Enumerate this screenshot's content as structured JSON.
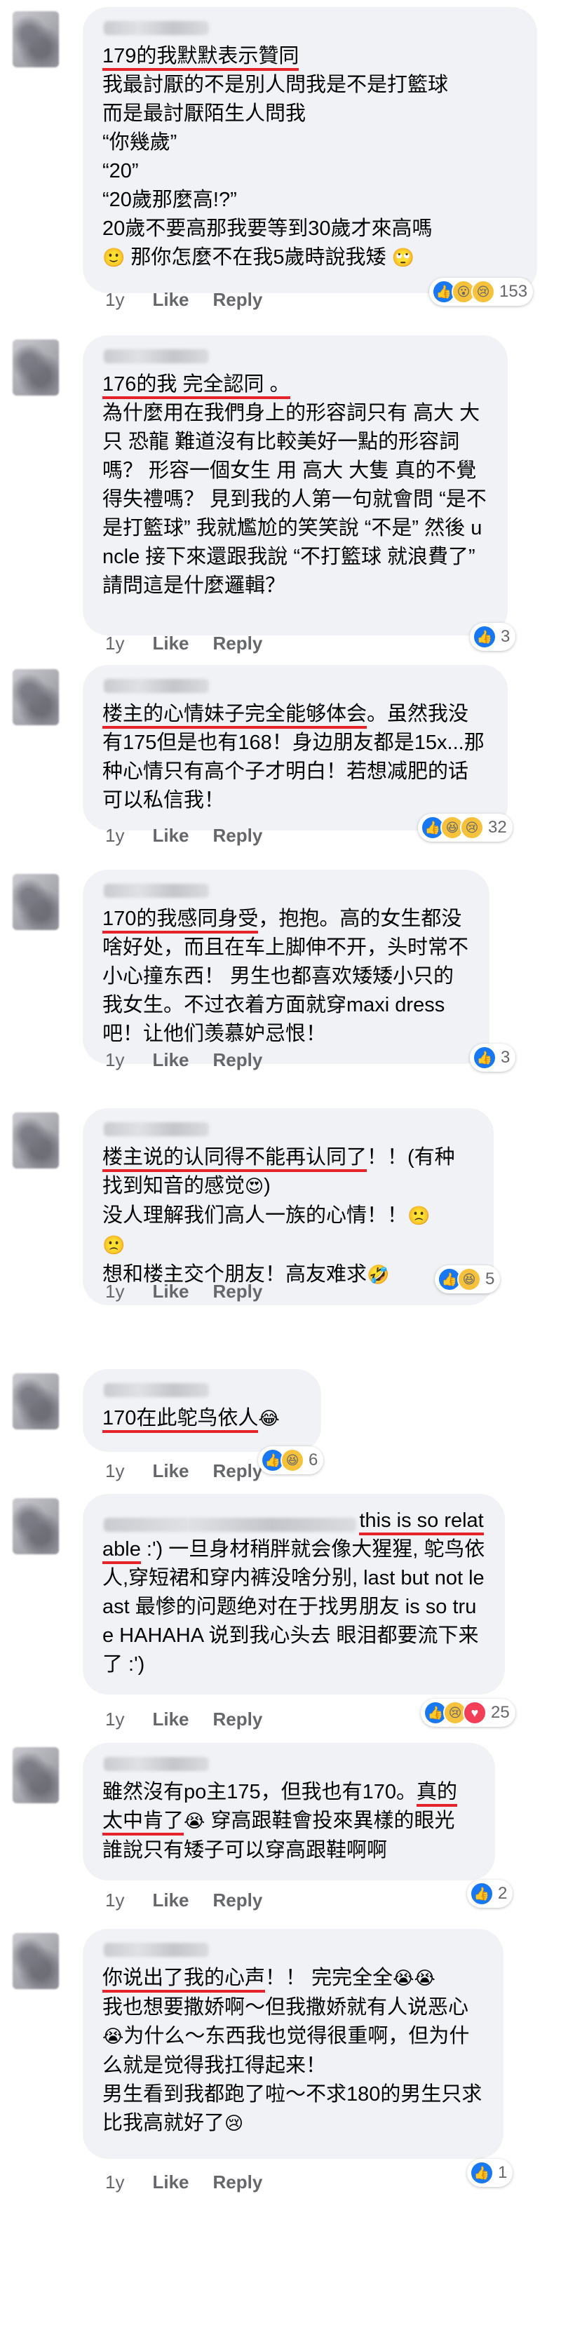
{
  "ui": {
    "like": "Like",
    "reply": "Reply"
  },
  "comments": [
    {
      "parts": [
        {
          "t": "179的我默默表示贊同",
          "hl": true
        },
        {
          "t": "\n我最討厭的不是別人問我是不是打籃球\n而是最討厭陌生人問我\n“你幾歲”\n“20”\n“20歲那麼高!?”\n20歲不要高那我要等到30歲才來高嗎\n"
        },
        {
          "t": "🙂",
          "e": true
        },
        {
          "t": " 那你怎麼不在我5歲時說我矮 "
        },
        {
          "t": "🙄",
          "e": true
        }
      ],
      "time": "1y",
      "reactions": [
        "like",
        "wow",
        "sad"
      ],
      "count": "153"
    },
    {
      "parts": [
        {
          "t": "176的我 完全認同 。",
          "hl": true
        },
        {
          "t": "\n為什麼用在我們身上的形容詞只有 高大 大只 恐龍 難道沒有比較美好一點的形容詞嗎？ 形容一個女生 用 高大 大隻 真的不覺得失禮嗎？ 見到我的人第一句就會問 “是不是打籃球” 我就尷尬的笑笑說 “不是” 然後 uncle 接下來還跟我說 “不打籃球 就浪費了” 請問這是什麼邏輯？"
        }
      ],
      "time": "1y",
      "reactions": [
        "like"
      ],
      "count": "3"
    },
    {
      "parts": [
        {
          "t": "楼主的心情妹子完全能够体会",
          "hl": true
        },
        {
          "t": "。虽然我没有175但是也有168！身边朋友都是15x...那种心情只有高个子才明白！若想减肥的话可以私信我！"
        }
      ],
      "time": "1y",
      "reactions": [
        "like",
        "haha",
        "sad"
      ],
      "count": "32"
    },
    {
      "parts": [
        {
          "t": "170的我感同身受",
          "hl": true
        },
        {
          "t": "，抱抱。高的女生都没啥好处，而且在车上脚伸不开，头时常不小心撞东西！ 男生也都喜欢矮矮小只的我女生。不过衣着方面就穿maxi dress 吧！让他们羡慕妒忌恨！"
        }
      ],
      "time": "1y",
      "reactions": [
        "like"
      ],
      "count": "3"
    },
    {
      "parts": [
        {
          "t": "楼主说的认同得不能再认同了",
          "hl": true
        },
        {
          "t": "！！(有种找到知音的感觉"
        },
        {
          "t": "😍",
          "e": true
        },
        {
          "t": ")\n没人理解我们高人一族的心情！！"
        },
        {
          "t": "🙁",
          "e": true
        },
        {
          "t": "\n"
        },
        {
          "t": "🙁",
          "e": true
        },
        {
          "t": "\n想和楼主交个朋友！高友难求"
        },
        {
          "t": "🤣",
          "e": true
        }
      ],
      "time": "1y",
      "reactions": [
        "like",
        "haha"
      ],
      "count": "5"
    },
    {
      "parts": [
        {
          "t": "170在此鸵鸟依人",
          "hl": true
        },
        {
          "t": "😂",
          "e": true
        }
      ],
      "time": "1y",
      "reactions": [
        "like",
        "haha"
      ],
      "count": "6"
    },
    {
      "parts": [
        {
          "t": "this is so relatable",
          "hl": true
        },
        {
          "t": " :') 一旦身材稍胖就会像大猩猩, 鸵鸟依人,穿短裙和穿内裤没啥分别, last but not least 最惨的问题绝对在于找男朋友 is so true HAHAHA 说到我心头去 眼泪都要流下来了 :')"
        }
      ],
      "time": "1y",
      "reactions": [
        "like",
        "sad",
        "love"
      ],
      "count": "25"
    },
    {
      "parts": [
        {
          "t": "雖然沒有po主175，但我也有170。"
        },
        {
          "t": "真的太中肯了",
          "hl": true
        },
        {
          "t": "😭",
          "e": true
        },
        {
          "t": " 穿高跟鞋會投來異樣的眼光 誰說只有矮子可以穿高跟鞋啊啊"
        }
      ],
      "time": "1y",
      "reactions": [
        "like"
      ],
      "count": "2"
    },
    {
      "parts": [
        {
          "t": "你说出了我的心声",
          "hl": true
        },
        {
          "t": "！！ 完完全全"
        },
        {
          "t": "😭😭",
          "e": true
        },
        {
          "t": "\n我也想要撒娇啊～但我撒娇就有人说恶心"
        },
        {
          "t": "😭",
          "e": true
        },
        {
          "t": "为什么～东西我也觉得很重啊，但为什么就是觉得我扛得起来！\n男生看到我都跑了啦～不求180的男生只求比我高就好了"
        },
        {
          "t": "😢",
          "e": true
        }
      ],
      "time": "1y",
      "reactions": [
        "like"
      ],
      "count": "1"
    }
  ]
}
